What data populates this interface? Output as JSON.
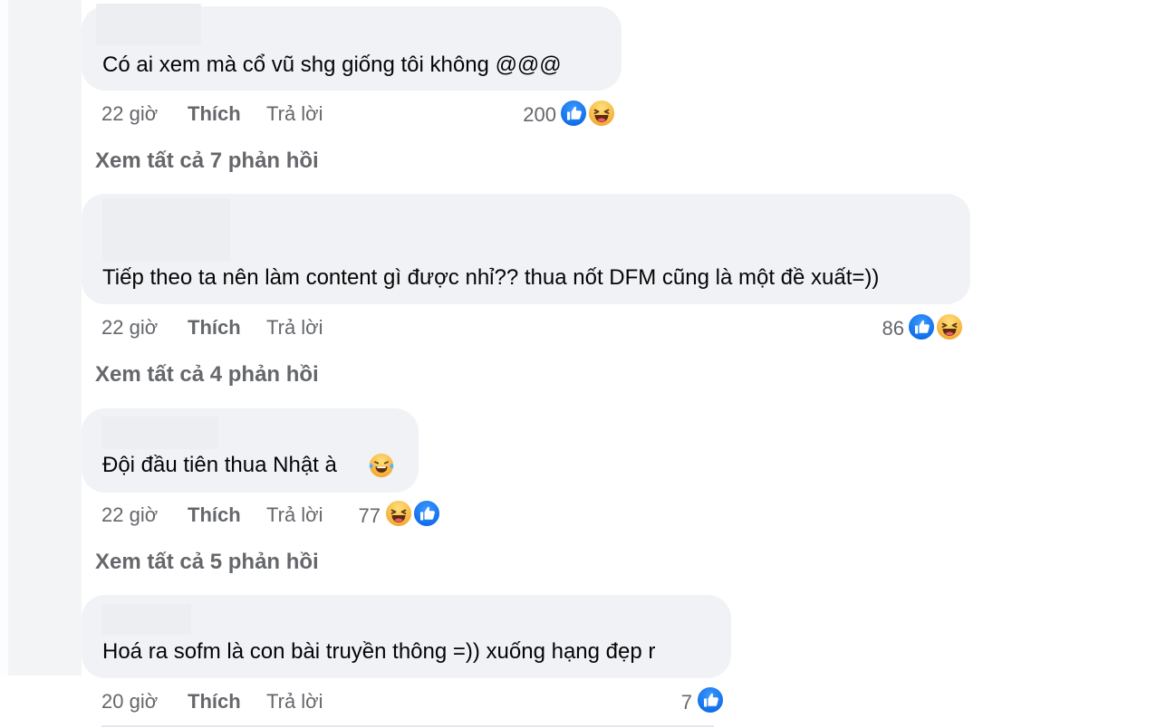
{
  "comments": [
    {
      "text": "Có ai xem mà cổ vũ shg giống tôi không @@@",
      "time": "22 giờ",
      "like_label": "Thích",
      "reply_label": "Trả lời",
      "reaction_count": "200",
      "reactions": [
        "like-icon",
        "haha-icon"
      ],
      "view_replies": "Xem tất cả 7 phản hồi"
    },
    {
      "text": "Tiếp theo ta nên làm content gì được nhỉ?? thua nốt DFM cũng là một đề xuất=))",
      "time": "22 giờ",
      "like_label": "Thích",
      "reply_label": "Trả lời",
      "reaction_count": "86",
      "reactions": [
        "like-icon",
        "haha-icon"
      ],
      "view_replies": "Xem tất cả 4 phản hồi"
    },
    {
      "text": "Đội đầu tiên thua Nhật à",
      "inline_emoji": "laugh-tears-icon",
      "time": "22 giờ",
      "like_label": "Thích",
      "reply_label": "Trả lời",
      "reaction_count": "77",
      "reactions": [
        "haha-icon",
        "like-icon"
      ],
      "view_replies": "Xem tất cả 5 phản hồi"
    },
    {
      "text": "Hoá ra sofm là con bài truyền thông =)) xuống hạng đẹp r",
      "time": "20 giờ",
      "like_label": "Thích",
      "reply_label": "Trả lời",
      "reaction_count": "7",
      "reactions": [
        "like-icon"
      ]
    }
  ],
  "colors": {
    "bubble": "#f0f2f5",
    "meta_text": "#65676b",
    "like_blue": "#1877f2",
    "haha_yellow": "#fcc844"
  }
}
